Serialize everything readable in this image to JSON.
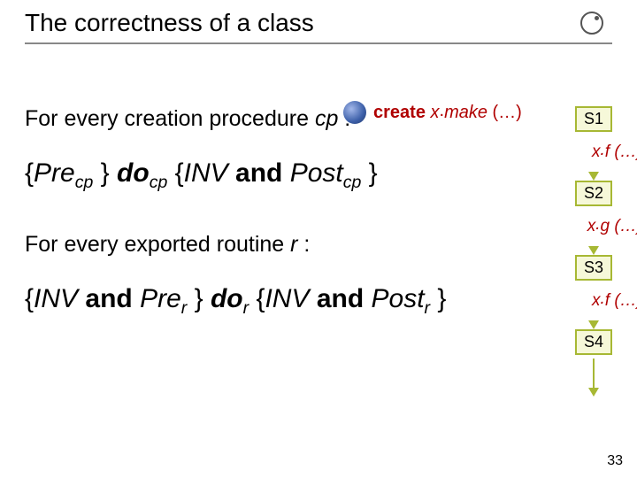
{
  "title": "The correctness of a class",
  "create_line": {
    "kw": "create",
    "rest": " x make (…)"
  },
  "lines": {
    "l1_a": "For every creation procedure ",
    "l1_cp": "cp",
    "l1_b": " :",
    "hoare1_open": "{",
    "hoare1_pre": "Pre",
    "hoare1_cp": "cp",
    "hoare1_mid1": " } ",
    "hoare1_do": "do",
    "hoare1_mid2": " {",
    "hoare1_inv": "INV",
    "hoare1_and": " and ",
    "hoare1_post": "Post",
    "hoare1_close": " }",
    "l2_a": "For every exported routine ",
    "l2_r": "r",
    "l2_b": " :",
    "hoare2_open": "{",
    "hoare2_inv1": "INV",
    "hoare2_and1": " and ",
    "hoare2_pre": "Pre",
    "hoare2_r1": "r",
    "hoare2_mid1": " } ",
    "hoare2_do": "do",
    "hoare2_mid2": " {",
    "hoare2_inv2": "INV",
    "hoare2_and2": " and ",
    "hoare2_post": "Post",
    "hoare2_r2": "r",
    "hoare2_close": " }"
  },
  "states": {
    "s1": "S1",
    "s2": "S2",
    "s3": "S3",
    "s4": "S4",
    "e1": "x f (…)",
    "e2": "x g (…)",
    "e3": "x f (…)"
  },
  "pagenum": "33"
}
